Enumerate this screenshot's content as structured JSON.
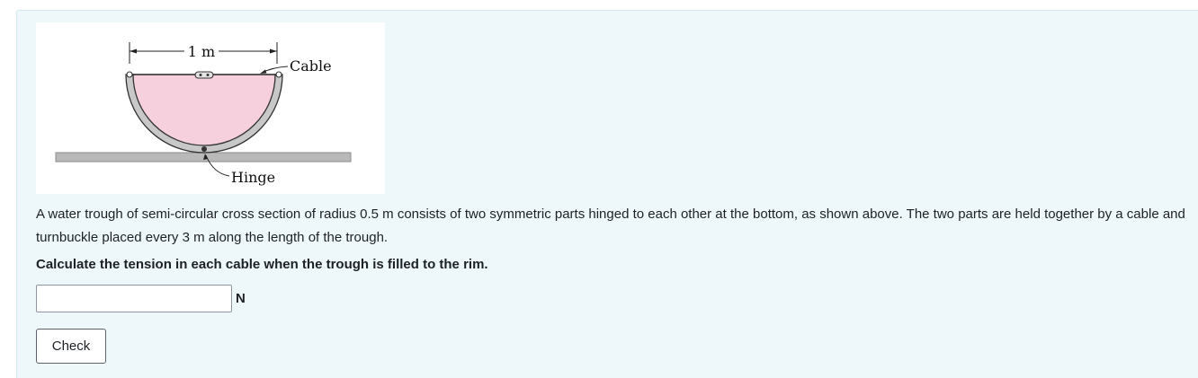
{
  "figure": {
    "dimension_label": "1 m",
    "cable_label": "Cable",
    "hinge_label": "Hinge",
    "colors": {
      "water": "#f6d0dc",
      "trough": "#c8c8c8",
      "ground": "#b9b9b9"
    }
  },
  "question": {
    "text": "A water trough of semi-circular cross section of radius 0.5 m consists of two symmetric parts hinged to each other at the bottom, as shown above. The two parts are held together by a cable and turnbuckle placed every 3 m along the length of the trough.",
    "prompt": "Calculate the tension in each cable when the trough is filled to the rim."
  },
  "answer": {
    "value": "",
    "placeholder": "",
    "unit": "N"
  },
  "check_button": {
    "label": "Check"
  }
}
